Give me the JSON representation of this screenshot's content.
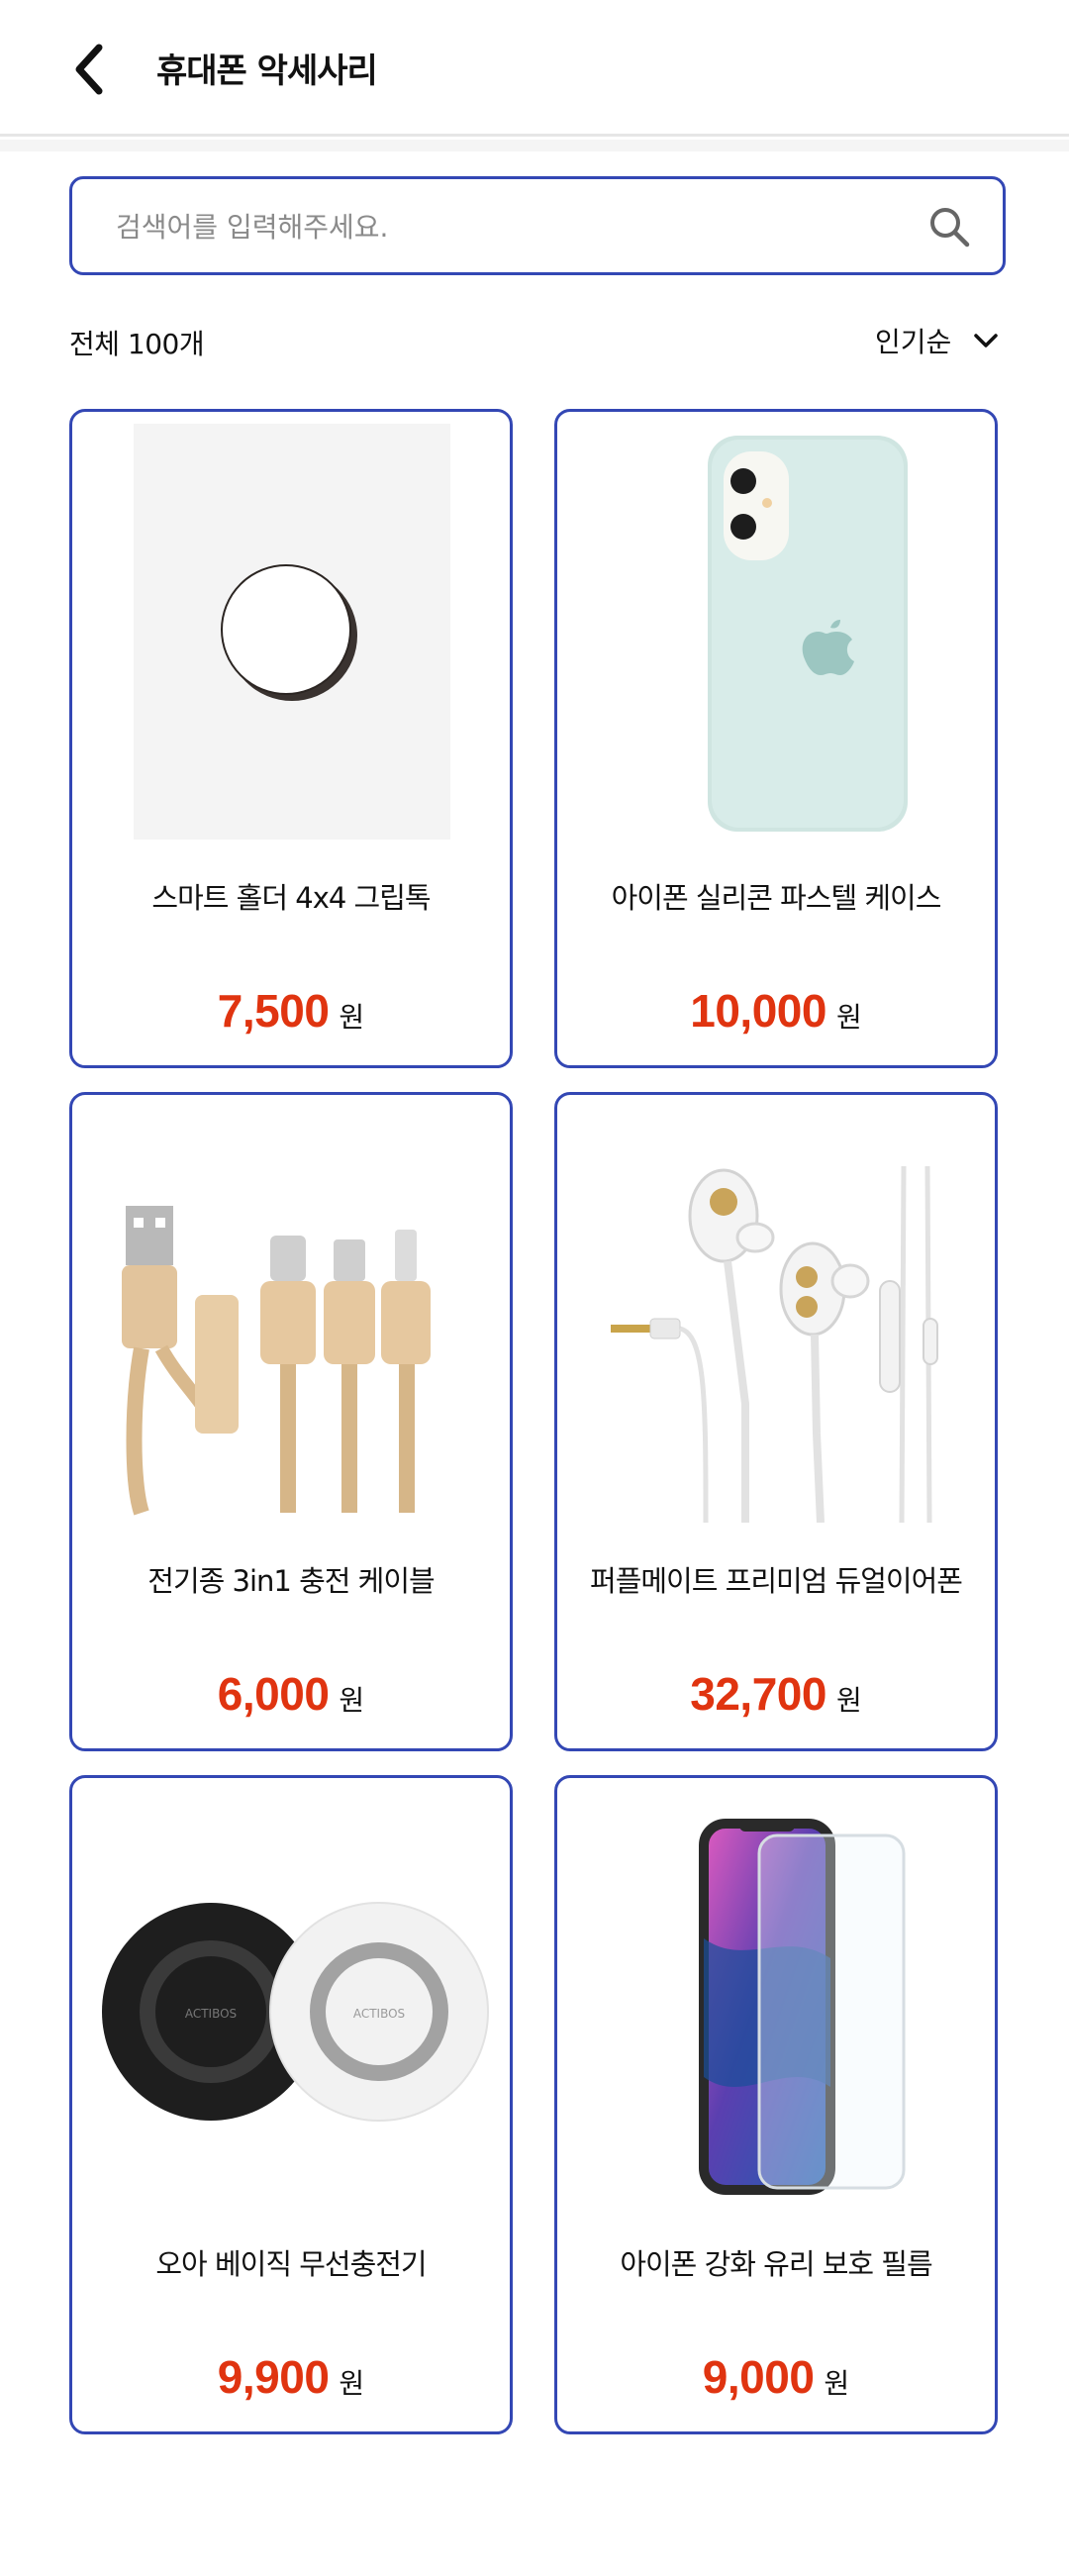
{
  "header": {
    "title": "휴대폰 악세사리",
    "back_icon": "chevron-left-icon"
  },
  "search": {
    "placeholder": "검색어를 입력해주세요.",
    "value": "",
    "icon": "search-icon"
  },
  "list": {
    "count_label": "전체 100개",
    "sort_label": "인기순",
    "sort_icon": "chevron-down-icon"
  },
  "colors": {
    "accent": "#3347b4",
    "price": "#e03410"
  },
  "products": [
    {
      "name": "스마트 홀더 4x4 그립톡",
      "price": "7,500",
      "unit": "원",
      "image": "grip-holder-image"
    },
    {
      "name": "아이폰 실리콘 파스텔 케이스",
      "price": "10,000",
      "unit": "원",
      "image": "silicone-case-image"
    },
    {
      "name": "전기종 3in1 충전 케이블",
      "price": "6,000",
      "unit": "원",
      "image": "charging-cable-image"
    },
    {
      "name": "퍼플메이트 프리미엄 듀얼이어폰",
      "price": "32,700",
      "unit": "원",
      "image": "earphones-image"
    },
    {
      "name": "오아 베이직 무선충전기",
      "price": "9,900",
      "unit": "원",
      "image": "wireless-charger-image",
      "brand_text": "ACTIBOS"
    },
    {
      "name": "아이폰 강화 유리 보호 필름",
      "price": "9,000",
      "unit": "원",
      "image": "screen-protector-image"
    }
  ]
}
